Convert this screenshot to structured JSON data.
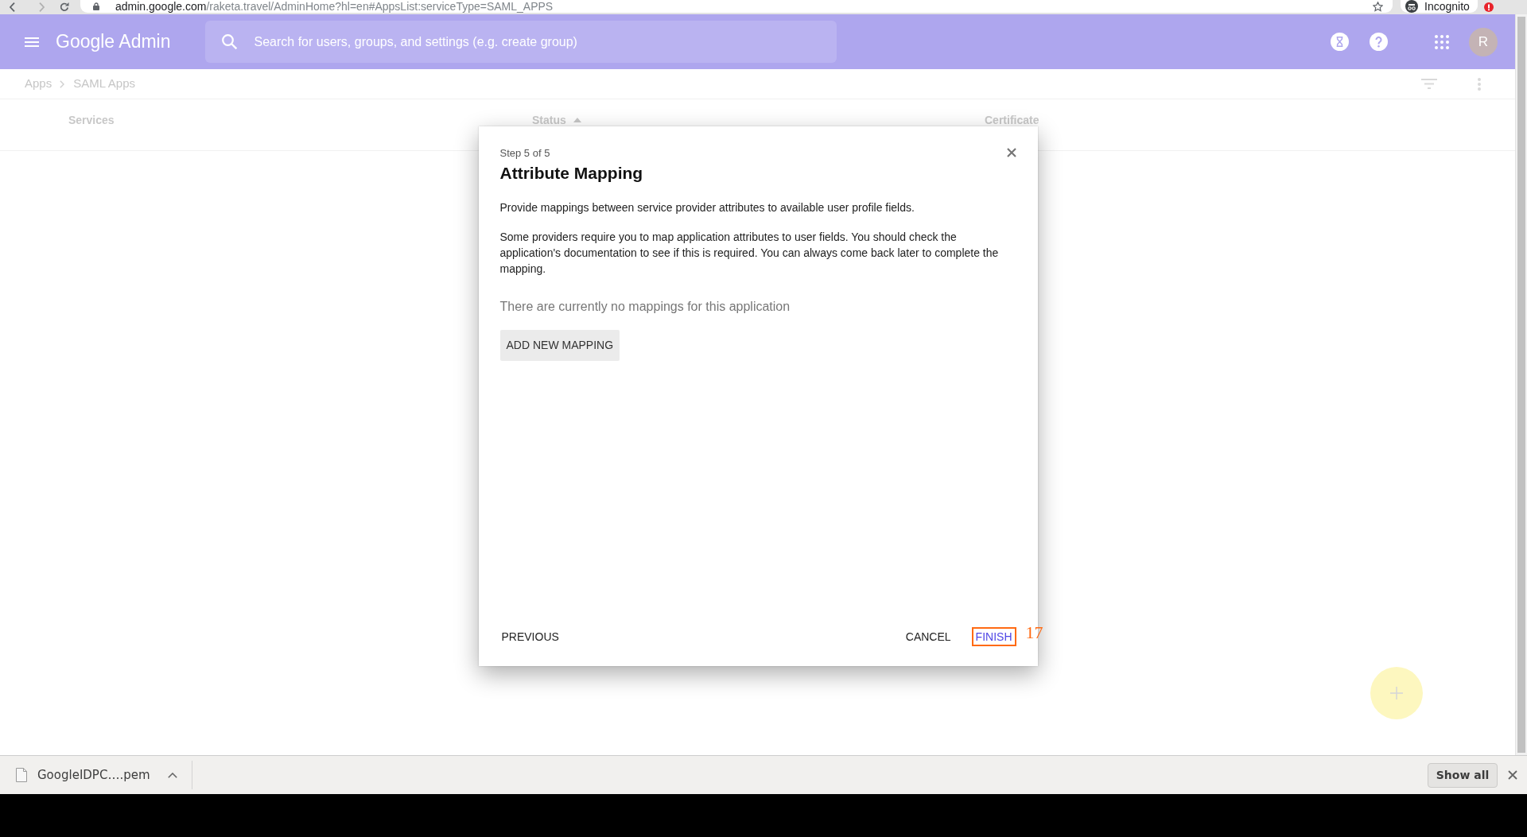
{
  "browser": {
    "url_host": "admin.google.com",
    "url_path": "/raketa.travel/AdminHome?hl=en#AppsList:serviceType=SAML_APPS",
    "profile_label": "Incognito"
  },
  "header": {
    "product": "Google Admin",
    "search": {
      "placeholder": "Search for users, groups, and settings (e.g. create group)"
    },
    "avatar_initial": "R"
  },
  "breadcrumb": [
    "Apps",
    "SAML Apps"
  ],
  "table": {
    "columns": [
      {
        "label": "Services",
        "sorted": false
      },
      {
        "label": "Status",
        "sorted": true
      },
      {
        "label": "Certificate",
        "sorted": false
      }
    ]
  },
  "dialog": {
    "step": "Step 5 of 5",
    "title": "Attribute Mapping",
    "paragraphs": [
      "Provide mappings between service provider attributes to available user profile fields.",
      "Some providers require you to map application attributes to user fields. You should check the application's documentation to see if this is required. You can always come back later to complete the mapping."
    ],
    "empty_message": "There are currently no mappings for this application",
    "add_button": "ADD NEW MAPPING",
    "buttons": [
      {
        "label": "PREVIOUS",
        "kind": "back",
        "highlighted": false
      },
      {
        "label": "CANCEL",
        "kind": "secondary",
        "highlighted": false
      },
      {
        "label": "FINISH",
        "kind": "primary",
        "highlighted": true
      }
    ],
    "highlight_label": "17"
  },
  "downloads": {
    "items": [
      {
        "name": "GoogleIDPC….pem"
      }
    ],
    "show_all": "Show all"
  }
}
